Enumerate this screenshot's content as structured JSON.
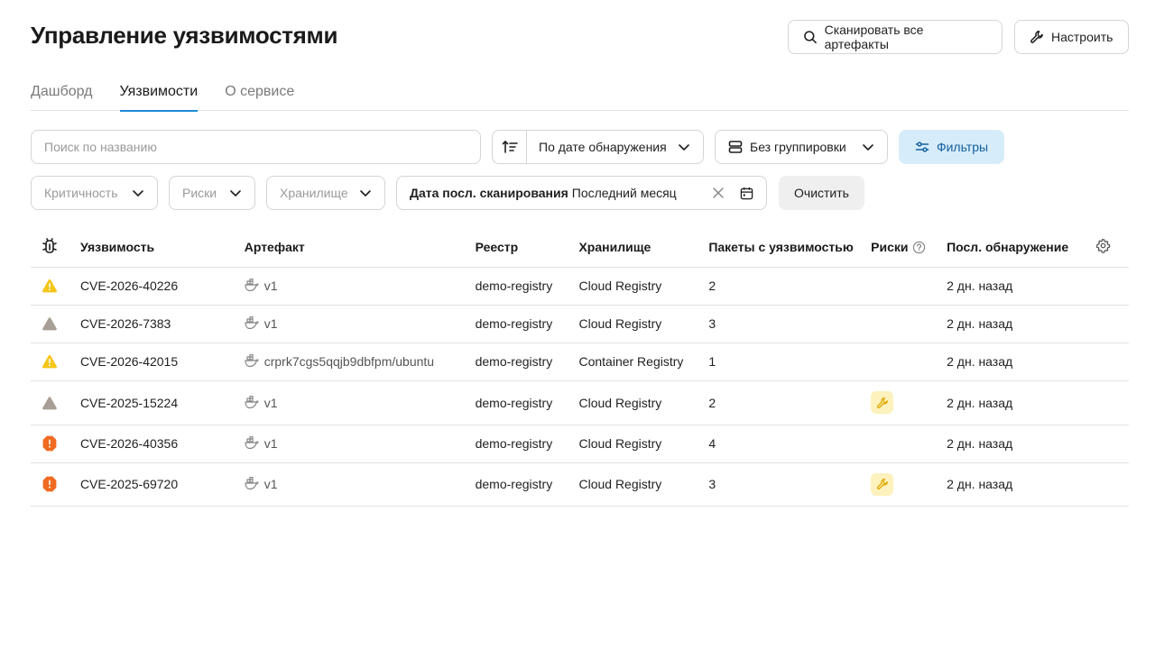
{
  "header": {
    "title": "Управление уязвимостями",
    "scan_all_label": "Сканировать все артефакты",
    "configure_label": "Настроить"
  },
  "tabs": [
    {
      "label": "Дашборд",
      "active": false
    },
    {
      "label": "Уязвимости",
      "active": true
    },
    {
      "label": "О сервисе",
      "active": false
    }
  ],
  "toolbar": {
    "search_placeholder": "Поиск по названию",
    "sort_value": "По дате обнаружения",
    "group_value": "Без группировки",
    "filters_label": "Фильтры",
    "criticality_placeholder": "Критичность",
    "risks_placeholder": "Риски",
    "storage_placeholder": "Хранилище",
    "date_filter_label": "Дата посл. сканирования",
    "date_filter_value": "Последний месяц",
    "clear_label": "Очистить"
  },
  "table": {
    "columns": {
      "vulnerability": "Уязвимость",
      "artifact": "Артефакт",
      "registry": "Реестр",
      "storage": "Хранилище",
      "packages": "Пакеты с уязвимостью",
      "risks": "Риски",
      "last_detected": "Посл. обнаружение"
    },
    "rows": [
      {
        "severity": "medium",
        "cve": "CVE-2026-40226",
        "artifact": "v1",
        "registry": "demo-registry",
        "storage": "Cloud Registry",
        "packages": "2",
        "risk": false,
        "last": "2 дн. назад"
      },
      {
        "severity": "low",
        "cve": "CVE-2026-7383",
        "artifact": "v1",
        "registry": "demo-registry",
        "storage": "Cloud Registry",
        "packages": "3",
        "risk": false,
        "last": "2 дн. назад"
      },
      {
        "severity": "medium",
        "cve": "CVE-2026-42015",
        "artifact": "crprk7cgs5qqjb9dbfpm/ubuntu",
        "registry": "demo-registry",
        "storage": "Container Registry",
        "packages": "1",
        "risk": false,
        "last": "2 дн. назад"
      },
      {
        "severity": "low",
        "cve": "CVE-2025-15224",
        "artifact": "v1",
        "registry": "demo-registry",
        "storage": "Cloud Registry",
        "packages": "2",
        "risk": true,
        "last": "2 дн. назад"
      },
      {
        "severity": "high",
        "cve": "CVE-2026-40356",
        "artifact": "v1",
        "registry": "demo-registry",
        "storage": "Cloud Registry",
        "packages": "4",
        "risk": false,
        "last": "2 дн. назад"
      },
      {
        "severity": "high",
        "cve": "CVE-2025-69720",
        "artifact": "v1",
        "registry": "demo-registry",
        "storage": "Cloud Registry",
        "packages": "3",
        "risk": true,
        "last": "2 дн. назад"
      }
    ]
  },
  "icons": {
    "severity_medium": "warning-triangle-yellow-icon",
    "severity_low": "triangle-gray-icon",
    "severity_high": "octagon-orange-icon",
    "risk": "wrench-icon",
    "artifact": "docker-icon"
  },
  "colors": {
    "accent": "#1f8ad6",
    "filters_bg": "#d7ecfa",
    "severity_medium": "#f5c518",
    "severity_low": "#a79f95",
    "severity_high": "#f06b22",
    "risk_badge_bg": "#fdf1bd"
  }
}
